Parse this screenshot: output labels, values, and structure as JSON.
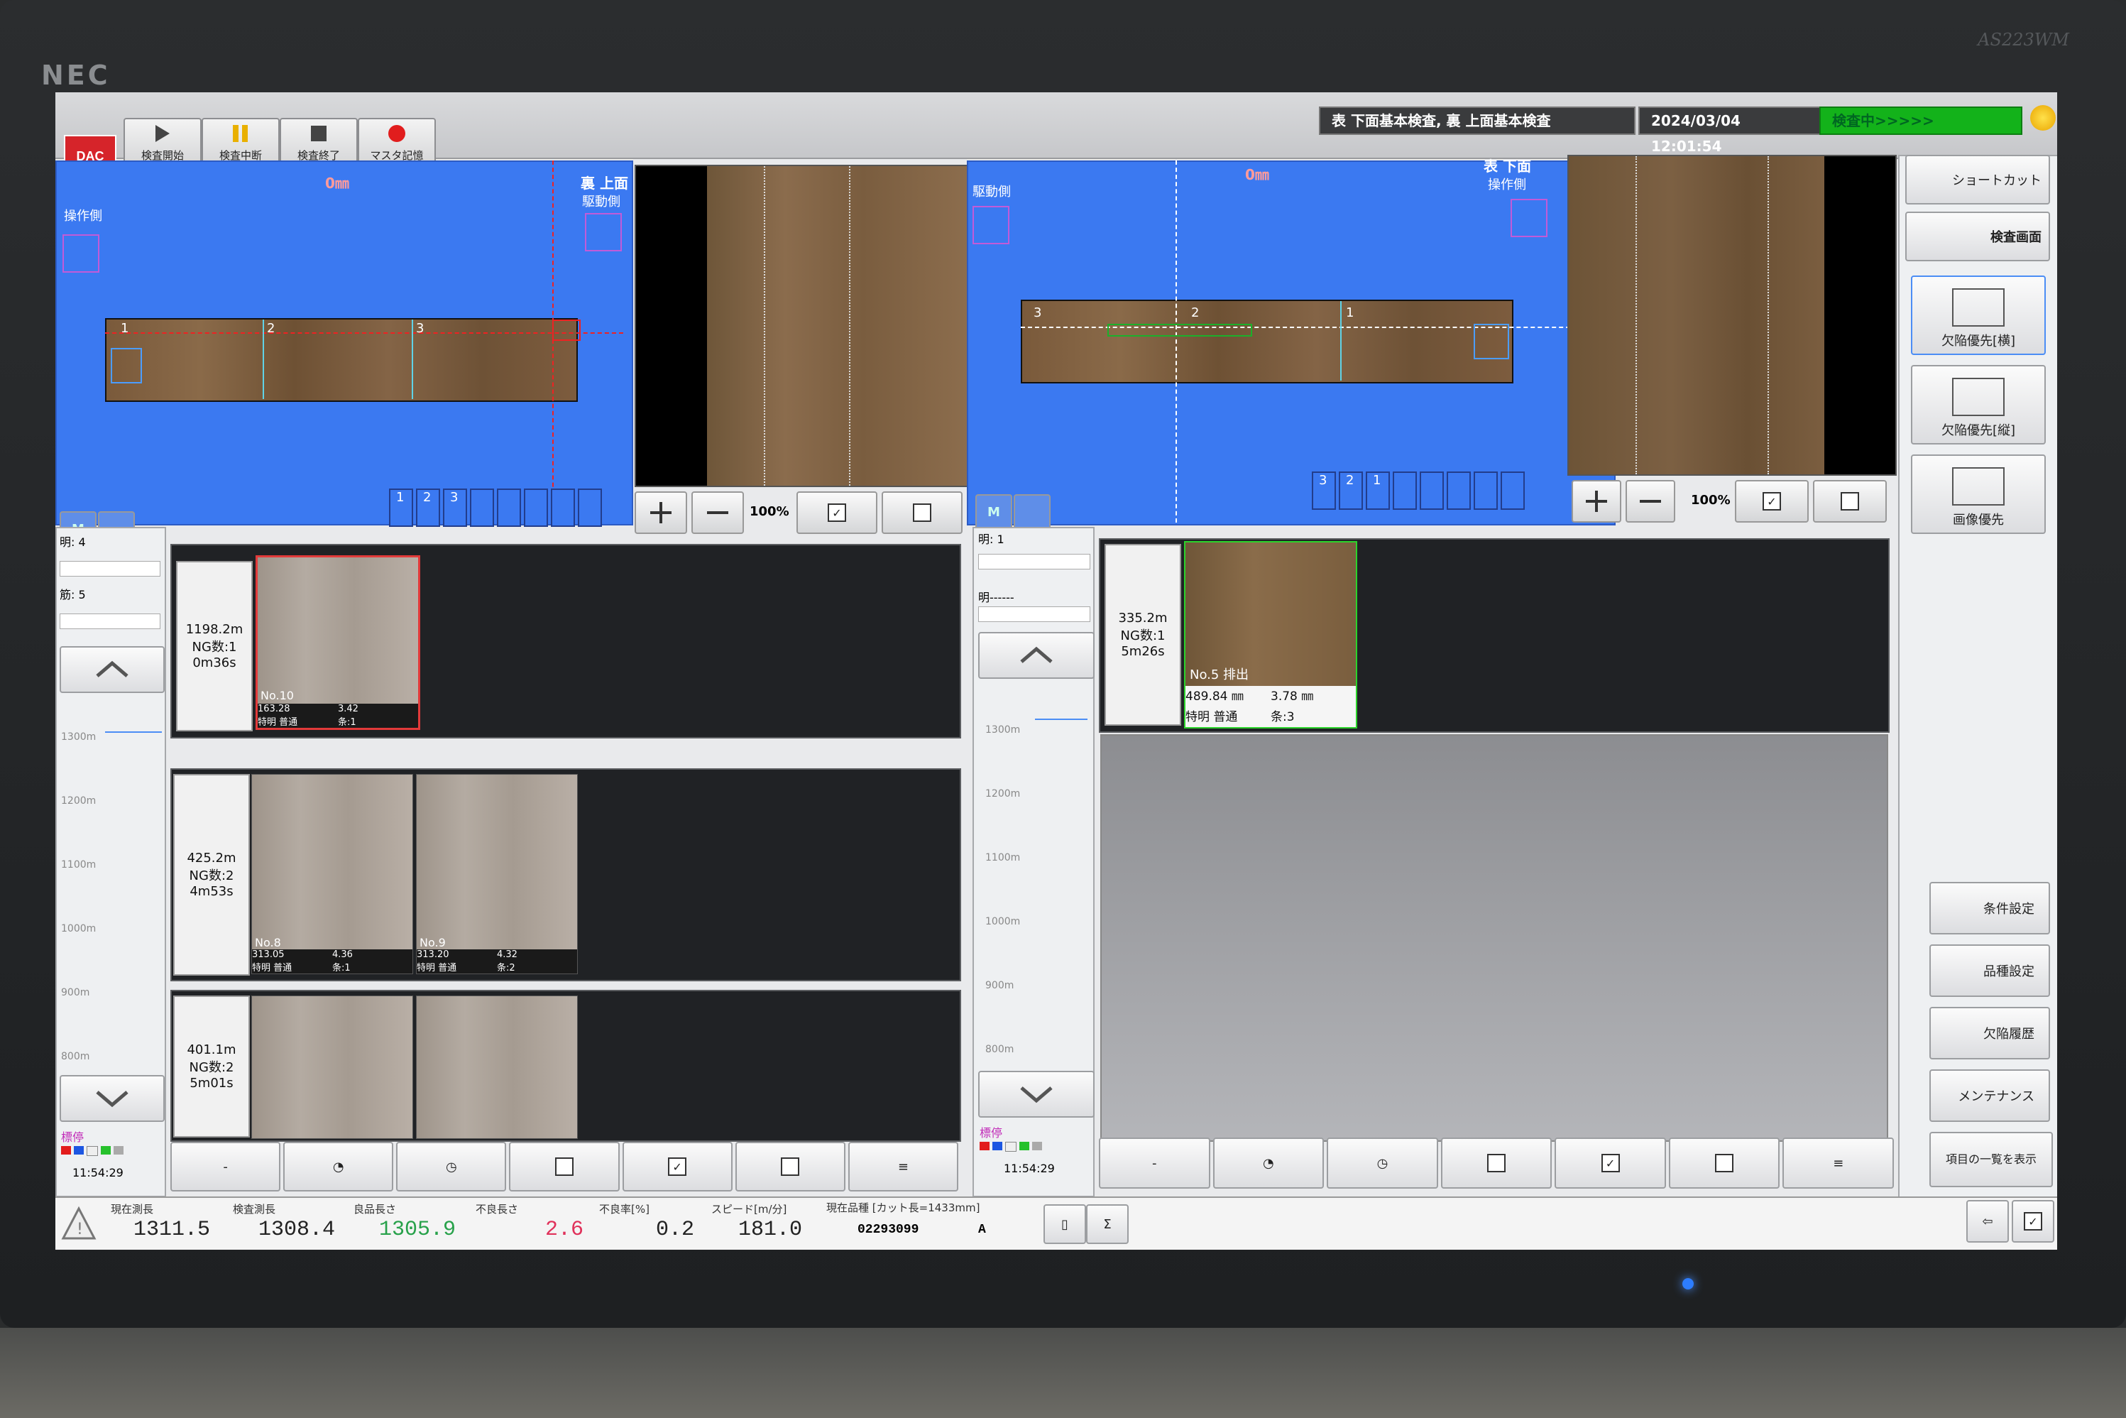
{
  "monitor": {
    "brand": "NEC",
    "model": "AS223WM"
  },
  "toolbar": {
    "logo": "DAC",
    "buttons": [
      "検査開始",
      "検査中断",
      "検査終了",
      "マスタ記憶"
    ],
    "mode_text": "表 下面基本検査, 裏 上面基本検査",
    "datetime": "2024/03/04 12:01:54",
    "status": "検査中>>>>>",
    "colors": {
      "status_green": "#13b21a",
      "record_red": "#e11d1d"
    }
  },
  "left_view": {
    "face": "裏 上面",
    "top_mark": "0㎜",
    "side_left": "操作側",
    "side_right": "駆動側",
    "marks": [
      "1",
      "2",
      "3"
    ],
    "lanes": [
      "1",
      "2",
      "3"
    ],
    "zoom": "100%",
    "m_label": "M"
  },
  "right_view": {
    "face": "表 下面",
    "top_mark": "0㎜",
    "side_left": "駆動側",
    "side_right": "操作側",
    "marks": [
      "3",
      "2",
      "1"
    ],
    "lanes": [
      "3",
      "2",
      "1"
    ],
    "zoom": "100%",
    "m_label": "M"
  },
  "left_filter": {
    "bright": "明: 4",
    "line": "筋: 5",
    "scale": [
      "1300m",
      "1200m",
      "1100m",
      "1000m",
      "900m",
      "800m"
    ],
    "legend": "標停",
    "time": "11:54:29"
  },
  "right_filter": {
    "bright": "明: 1",
    "line": "明------",
    "scale": [
      "1300m",
      "1200m",
      "1100m",
      "1000m",
      "900m",
      "800m"
    ],
    "legend": "標停",
    "time": "11:54:29"
  },
  "left_defects": [
    {
      "pos": "1198.2m",
      "ng": "NG数:1",
      "time": "0m36s",
      "thumbs": [
        {
          "no": "No.10",
          "a": "163.28",
          "b": "3.42",
          "c": "特明 普通",
          "d": "条:1"
        }
      ]
    },
    {
      "pos": "425.2m",
      "ng": "NG数:2",
      "time": "4m53s",
      "thumbs": [
        {
          "no": "No.8",
          "a": "313.05",
          "b": "4.36",
          "c": "特明 普通",
          "d": "条:1"
        },
        {
          "no": "No.9",
          "a": "313.20",
          "b": "4.32",
          "c": "特明 普通",
          "d": "条:2"
        }
      ]
    },
    {
      "pos": "401.1m",
      "ng": "NG数:2",
      "time": "5m01s",
      "thumbs": []
    }
  ],
  "right_defects": [
    {
      "pos": "335.2m",
      "ng": "NG数:1",
      "time": "5m26s",
      "thumbs": [
        {
          "no": "No.5 排出",
          "a": "489.84 ㎜",
          "b": "3.78 ㎜",
          "c": "特明 普通",
          "d": "条:3"
        }
      ]
    }
  ],
  "sidebar": {
    "top": [
      "ショートカット",
      "検査画面"
    ],
    "views": [
      "欠陥優先[横]",
      "欠陥優先[縦]",
      "画像優先"
    ],
    "bottom": [
      "条件設定",
      "品種設定",
      "欠陥履歴",
      "メンテナンス",
      "項目の一覧を表示"
    ]
  },
  "bottom": {
    "labels": [
      "現在測長",
      "検査測長",
      "良品長さ",
      "不良長さ",
      "不良率[%]",
      "スピード[m/分]",
      "現在品種 [カット長=1433mm]"
    ],
    "values": [
      "1311.5",
      "1308.4",
      "1305.9",
      "2.6",
      "0.2",
      "181.0"
    ],
    "product": "02293099",
    "product_code": "A",
    "colors": {
      "good": "#27a14a",
      "bad": "#e0315a"
    }
  }
}
